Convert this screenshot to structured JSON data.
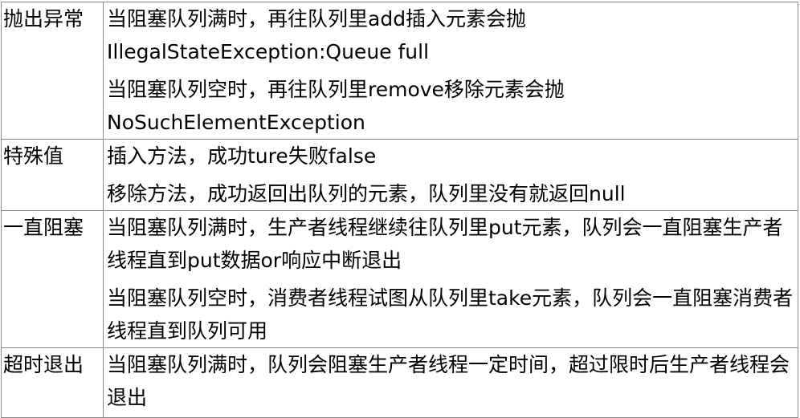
{
  "table": {
    "rows": [
      {
        "label": "抛出异常",
        "paragraphs": [
          "当阻塞队列满时，再往队列里add插入元素会抛IllegalStateException:Queue full",
          "当阻塞队列空时，再往队列里remove移除元素会抛NoSuchElementException"
        ]
      },
      {
        "label": "特殊值",
        "paragraphs": [
          "插入方法，成功ture失败false",
          "移除方法，成功返回出队列的元素，队列里没有就返回null"
        ]
      },
      {
        "label": "一直阻塞",
        "paragraphs": [
          "当阻塞队列满时，生产者线程继续往队列里put元素，队列会一直阻塞生产者线程直到put数据or响应中断退出",
          "当阻塞队列空时，消费者线程试图从队列里take元素，队列会一直阻塞消费者线程直到队列可用"
        ]
      },
      {
        "label": "超时退出",
        "paragraphs": [
          "当阻塞队列满时，队列会阻塞生产者线程一定时间，超过限时后生产者线程会退出"
        ]
      }
    ]
  }
}
